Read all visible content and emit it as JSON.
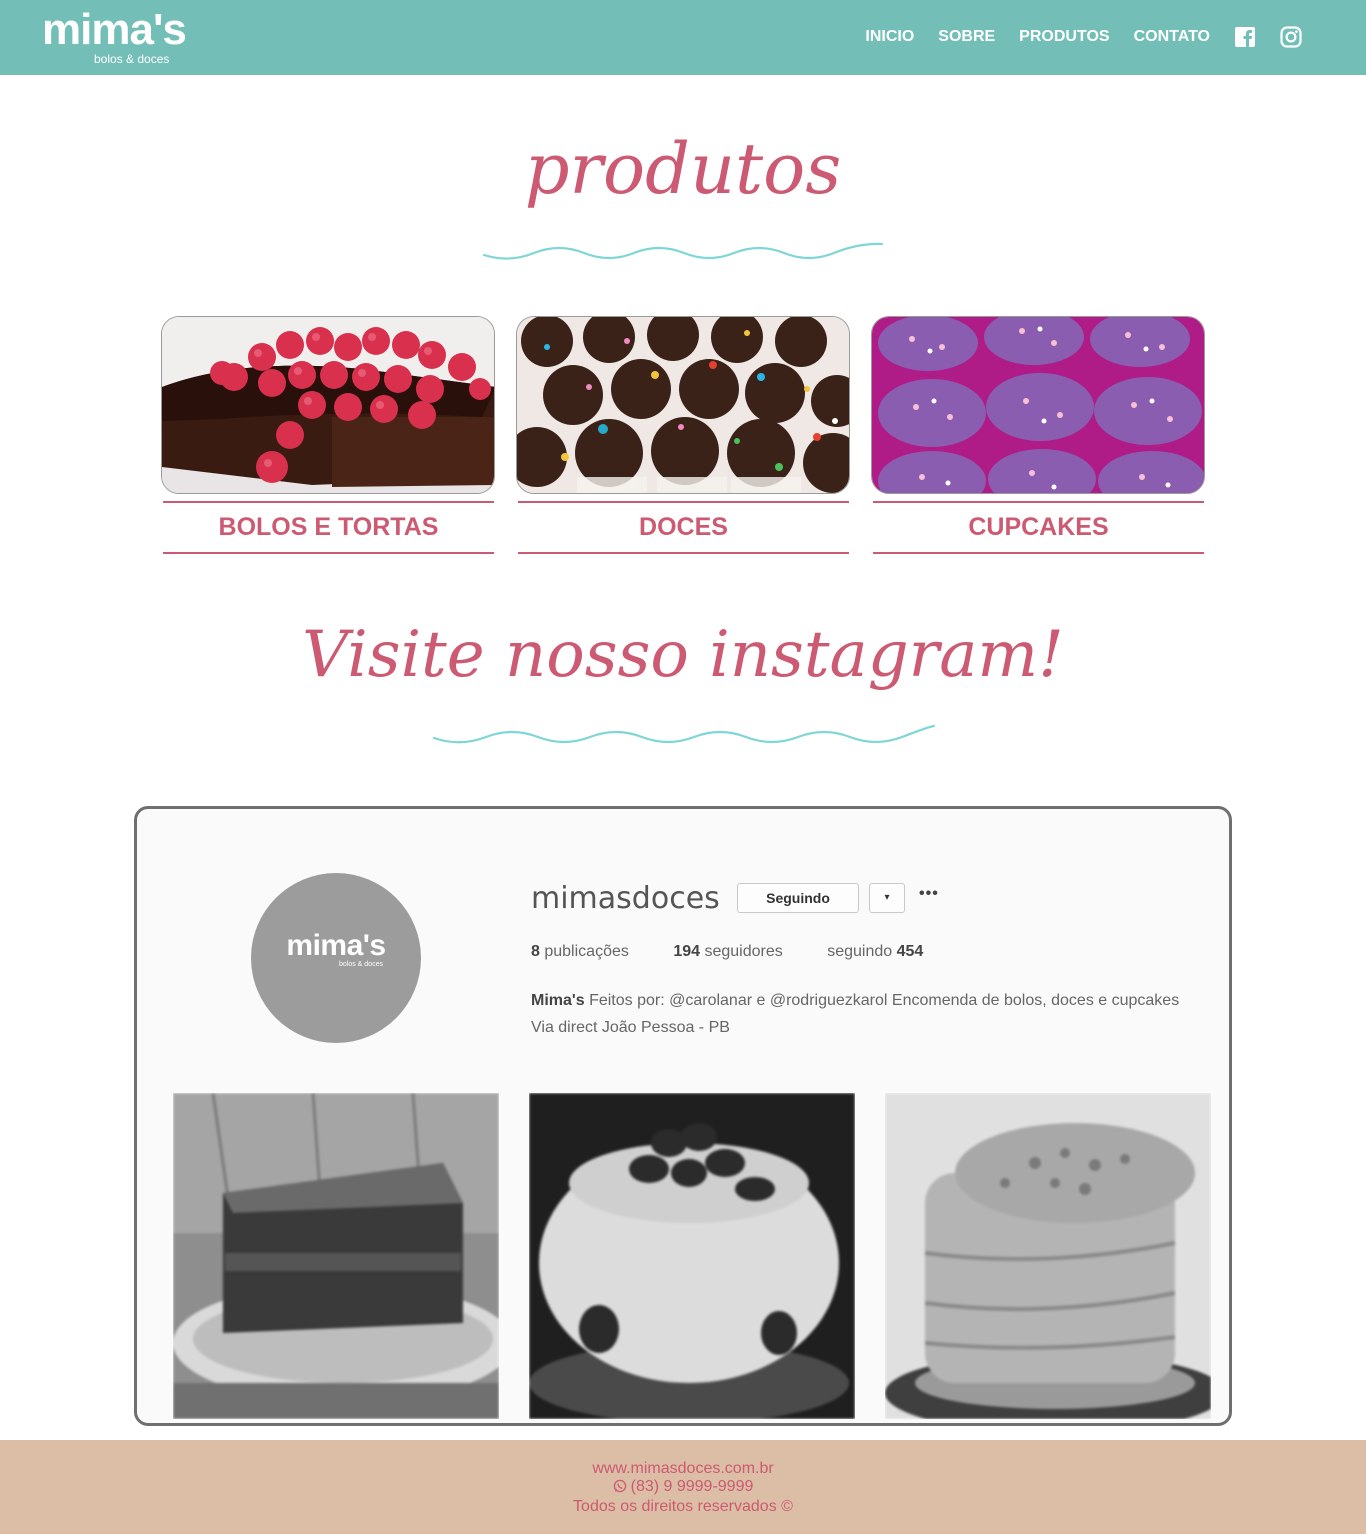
{
  "header": {
    "logo_main": "mima's",
    "logo_sub": "bolos & doces",
    "nav": [
      "INICIO",
      "SOBRE",
      "PRODUTOS",
      "CONTATO"
    ],
    "social_icons": [
      "facebook-icon",
      "instagram-icon"
    ]
  },
  "products": {
    "title": "produtos",
    "items": [
      {
        "label": "BOLOS E TORTAS",
        "image": "chocolate-raspberry-cake"
      },
      {
        "label": "DOCES",
        "image": "brigadeiros"
      },
      {
        "label": "CUPCAKES",
        "image": "purple-cupcakes"
      }
    ]
  },
  "instagram": {
    "title": "Visite nosso instagram!",
    "avatar_main": "mima's",
    "avatar_sub": "bolos & doces",
    "username": "mimasdoces",
    "follow_button": "Seguindo",
    "dropdown": "▾",
    "more": "•••",
    "stats": {
      "posts_count": "8",
      "posts_label": "publicações",
      "followers_count": "194",
      "followers_label": "seguidores",
      "following_label": "seguindo",
      "following_count": "454"
    },
    "bio_name": "Mima's",
    "bio_text": "Feitos por: @carolanar e @rodriguezkarol Encomenda de bolos, doces e cupcakes Via direct João Pessoa - PB"
  },
  "footer": {
    "website": "www.mimasdoces.com.br",
    "phone": "(83) 9 9999-9999",
    "rights": "Todos os direitos reservados ©"
  },
  "colors": {
    "header_bg": "#73bfb7",
    "accent_pink": "#cc5a72",
    "wave_teal": "#7fd6d6",
    "footer_bg": "#dcbea6"
  }
}
